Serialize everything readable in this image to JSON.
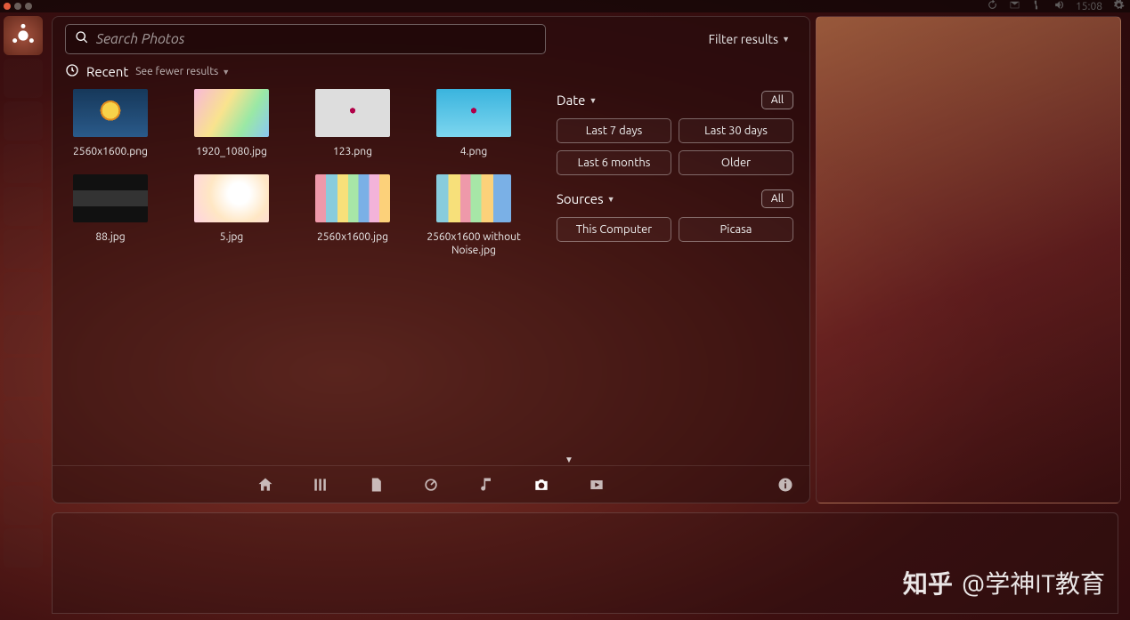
{
  "topbar": {
    "time": "15:08"
  },
  "search": {
    "placeholder": "Search Photos"
  },
  "header": {
    "filter_results": "Filter results",
    "recent": "Recent",
    "see_fewer": "See fewer results"
  },
  "photos": [
    {
      "label": "2560x1600.png",
      "style": "img-flower"
    },
    {
      "label": "1920_1080.jpg",
      "style": "img-gradient1"
    },
    {
      "label": "123.png",
      "style": "img-deb1"
    },
    {
      "label": "4.png",
      "style": "img-deb2"
    },
    {
      "label": "88.jpg",
      "style": "img-spectrum"
    },
    {
      "label": "5.jpg",
      "style": "img-soft"
    },
    {
      "label": "2560x1600.jpg",
      "style": "img-blocks1"
    },
    {
      "label": "2560x1600 without Noise.jpg",
      "style": "img-blocks2"
    }
  ],
  "filters": {
    "date": {
      "title": "Date",
      "all": "All",
      "options": [
        "Last 7 days",
        "Last 30 days",
        "Last 6 months",
        "Older"
      ]
    },
    "sources": {
      "title": "Sources",
      "all": "All",
      "options": [
        "This Computer",
        "Picasa"
      ]
    }
  },
  "watermark": {
    "brand": "知乎",
    "handle": "@学神IT教育"
  }
}
